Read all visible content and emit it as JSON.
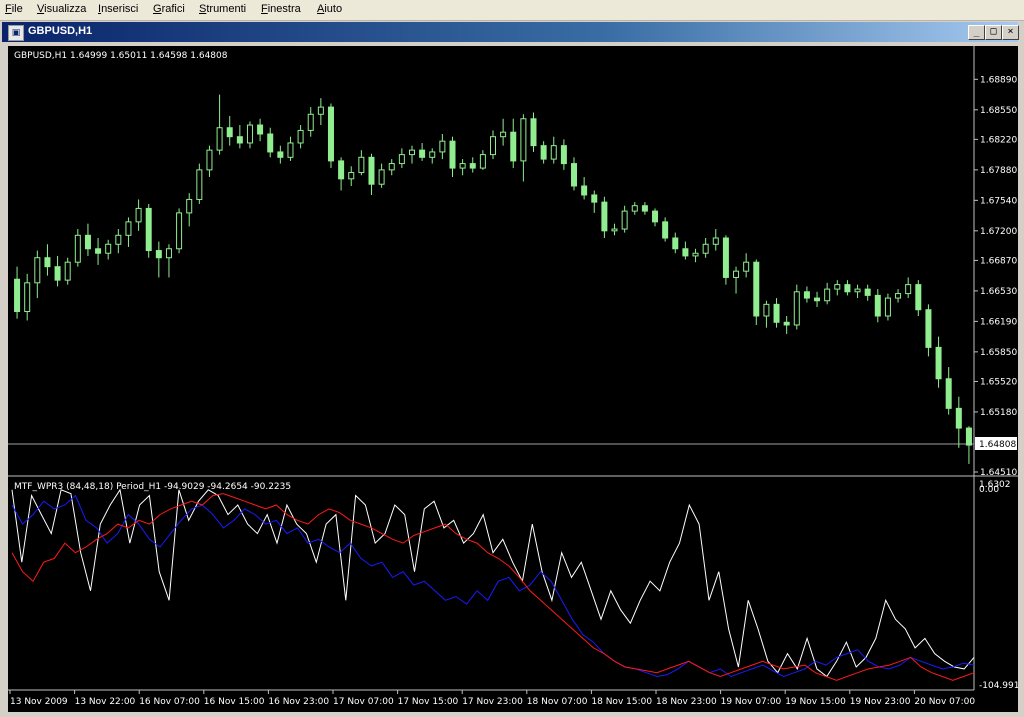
{
  "menu": [
    {
      "first": "F",
      "rest": "ile"
    },
    {
      "first": "V",
      "rest": "isualizza"
    },
    {
      "first": "I",
      "rest": "nserisci"
    },
    {
      "first": "G",
      "rest": "rafici"
    },
    {
      "first": "S",
      "rest": "trumenti"
    },
    {
      "first": "F",
      "rest": "inestra"
    },
    {
      "first": "A",
      "rest": "iuto"
    }
  ],
  "window": {
    "title": "GBPUSD,H1",
    "buttons": {
      "minimize": "_",
      "restore": "□",
      "close": "×"
    }
  },
  "price_panel": {
    "header": "GBPUSD,H1  1.64999 1.65011 1.64598 1.64808",
    "current_price": "1.64808",
    "axis_labels": [
      "1.68890",
      "1.68550",
      "1.68220",
      "1.67880",
      "1.67540",
      "1.67200",
      "1.66870",
      "1.66530",
      "1.66190",
      "1.65850",
      "1.65520",
      "1.65180",
      "1.64510"
    ]
  },
  "indicator_panel": {
    "header": "MTF_WPR3 (84,48,18) Period_H1 -94.9029 -94.2654 -90.2235",
    "axis_top": "0.00",
    "axis_top_overlap": "1.6302",
    "axis_bottom": "-104.991"
  },
  "time_axis": [
    "13 Nov 2009",
    "13 Nov 22:00",
    "16 Nov 07:00",
    "16 Nov 15:00",
    "16 Nov 23:00",
    "17 Nov 07:00",
    "17 Nov 15:00",
    "17 Nov 23:00",
    "18 Nov 07:00",
    "18 Nov 15:00",
    "18 Nov 23:00",
    "19 Nov 07:00",
    "19 Nov 15:00",
    "19 Nov 23:00",
    "20 Nov 07:00"
  ],
  "colors": {
    "background": "#000000",
    "candle": "#90ee90",
    "white_line": "#ffffff",
    "blue_line": "#1a1aff",
    "red_line": "#ff1a1a",
    "grid": "#c0c0c0"
  },
  "chart_data": {
    "type": "candlestick",
    "symbol": "GBPUSD",
    "timeframe": "H1",
    "ylim": [
      1.6451,
      1.6915
    ],
    "candles": [
      {
        "o": 1.6666,
        "h": 1.668,
        "l": 1.6622,
        "c": 1.663
      },
      {
        "o": 1.663,
        "h": 1.6672,
        "l": 1.662,
        "c": 1.6662
      },
      {
        "o": 1.6662,
        "h": 1.6698,
        "l": 1.6645,
        "c": 1.669
      },
      {
        "o": 1.669,
        "h": 1.6705,
        "l": 1.667,
        "c": 1.668
      },
      {
        "o": 1.668,
        "h": 1.6692,
        "l": 1.6658,
        "c": 1.6665
      },
      {
        "o": 1.6665,
        "h": 1.669,
        "l": 1.666,
        "c": 1.6685
      },
      {
        "o": 1.6685,
        "h": 1.6722,
        "l": 1.668,
        "c": 1.6715
      },
      {
        "o": 1.6715,
        "h": 1.6728,
        "l": 1.6692,
        "c": 1.67
      },
      {
        "o": 1.67,
        "h": 1.6712,
        "l": 1.6682,
        "c": 1.6695
      },
      {
        "o": 1.6695,
        "h": 1.671,
        "l": 1.6688,
        "c": 1.6705
      },
      {
        "o": 1.6705,
        "h": 1.6722,
        "l": 1.6695,
        "c": 1.6715
      },
      {
        "o": 1.6715,
        "h": 1.6735,
        "l": 1.6702,
        "c": 1.673
      },
      {
        "o": 1.673,
        "h": 1.6755,
        "l": 1.672,
        "c": 1.6745
      },
      {
        "o": 1.6745,
        "h": 1.675,
        "l": 1.669,
        "c": 1.6698
      },
      {
        "o": 1.6698,
        "h": 1.6708,
        "l": 1.6668,
        "c": 1.669
      },
      {
        "o": 1.669,
        "h": 1.6705,
        "l": 1.6668,
        "c": 1.67
      },
      {
        "o": 1.67,
        "h": 1.6745,
        "l": 1.6695,
        "c": 1.674
      },
      {
        "o": 1.674,
        "h": 1.6762,
        "l": 1.6725,
        "c": 1.6755
      },
      {
        "o": 1.6755,
        "h": 1.6795,
        "l": 1.675,
        "c": 1.6788
      },
      {
        "o": 1.6788,
        "h": 1.6815,
        "l": 1.678,
        "c": 1.681
      },
      {
        "o": 1.681,
        "h": 1.6872,
        "l": 1.6805,
        "c": 1.6835
      },
      {
        "o": 1.6835,
        "h": 1.6848,
        "l": 1.6815,
        "c": 1.6825
      },
      {
        "o": 1.6825,
        "h": 1.6838,
        "l": 1.6812,
        "c": 1.6818
      },
      {
        "o": 1.6818,
        "h": 1.6842,
        "l": 1.6812,
        "c": 1.6838
      },
      {
        "o": 1.6838,
        "h": 1.6845,
        "l": 1.682,
        "c": 1.6828
      },
      {
        "o": 1.6828,
        "h": 1.6835,
        "l": 1.6802,
        "c": 1.6808
      },
      {
        "o": 1.6808,
        "h": 1.6815,
        "l": 1.6795,
        "c": 1.6802
      },
      {
        "o": 1.6802,
        "h": 1.6825,
        "l": 1.6798,
        "c": 1.6818
      },
      {
        "o": 1.6818,
        "h": 1.6838,
        "l": 1.6812,
        "c": 1.6832
      },
      {
        "o": 1.6832,
        "h": 1.6858,
        "l": 1.6825,
        "c": 1.685
      },
      {
        "o": 1.685,
        "h": 1.6868,
        "l": 1.6838,
        "c": 1.6858
      },
      {
        "o": 1.6858,
        "h": 1.6862,
        "l": 1.679,
        "c": 1.6798
      },
      {
        "o": 1.6798,
        "h": 1.6802,
        "l": 1.6765,
        "c": 1.6778
      },
      {
        "o": 1.6778,
        "h": 1.6792,
        "l": 1.677,
        "c": 1.6785
      },
      {
        "o": 1.6785,
        "h": 1.681,
        "l": 1.6782,
        "c": 1.6802
      },
      {
        "o": 1.6802,
        "h": 1.6806,
        "l": 1.676,
        "c": 1.6772
      },
      {
        "o": 1.6772,
        "h": 1.6795,
        "l": 1.6768,
        "c": 1.6788
      },
      {
        "o": 1.6788,
        "h": 1.68,
        "l": 1.6782,
        "c": 1.6795
      },
      {
        "o": 1.6795,
        "h": 1.6812,
        "l": 1.679,
        "c": 1.6805
      },
      {
        "o": 1.6805,
        "h": 1.6815,
        "l": 1.6795,
        "c": 1.681
      },
      {
        "o": 1.681,
        "h": 1.6818,
        "l": 1.6798,
        "c": 1.6802
      },
      {
        "o": 1.6802,
        "h": 1.6812,
        "l": 1.6795,
        "c": 1.6808
      },
      {
        "o": 1.6808,
        "h": 1.6828,
        "l": 1.68,
        "c": 1.682
      },
      {
        "o": 1.682,
        "h": 1.6825,
        "l": 1.678,
        "c": 1.679
      },
      {
        "o": 1.679,
        "h": 1.68,
        "l": 1.6782,
        "c": 1.6795
      },
      {
        "o": 1.6795,
        "h": 1.6802,
        "l": 1.6785,
        "c": 1.679
      },
      {
        "o": 1.679,
        "h": 1.681,
        "l": 1.6788,
        "c": 1.6805
      },
      {
        "o": 1.6805,
        "h": 1.6832,
        "l": 1.68,
        "c": 1.6825
      },
      {
        "o": 1.6825,
        "h": 1.6845,
        "l": 1.6815,
        "c": 1.683
      },
      {
        "o": 1.683,
        "h": 1.6845,
        "l": 1.679,
        "c": 1.6798
      },
      {
        "o": 1.6798,
        "h": 1.685,
        "l": 1.6775,
        "c": 1.6845
      },
      {
        "o": 1.6845,
        "h": 1.6852,
        "l": 1.6808,
        "c": 1.6815
      },
      {
        "o": 1.6815,
        "h": 1.682,
        "l": 1.6795,
        "c": 1.68
      },
      {
        "o": 1.68,
        "h": 1.6825,
        "l": 1.6795,
        "c": 1.6815
      },
      {
        "o": 1.6815,
        "h": 1.6822,
        "l": 1.6788,
        "c": 1.6795
      },
      {
        "o": 1.6795,
        "h": 1.6802,
        "l": 1.6765,
        "c": 1.677
      },
      {
        "o": 1.677,
        "h": 1.678,
        "l": 1.6755,
        "c": 1.676
      },
      {
        "o": 1.676,
        "h": 1.6765,
        "l": 1.674,
        "c": 1.6752
      },
      {
        "o": 1.6752,
        "h": 1.6758,
        "l": 1.6712,
        "c": 1.672
      },
      {
        "o": 1.672,
        "h": 1.6728,
        "l": 1.6715,
        "c": 1.6722
      },
      {
        "o": 1.6722,
        "h": 1.6748,
        "l": 1.6718,
        "c": 1.6742
      },
      {
        "o": 1.6742,
        "h": 1.6752,
        "l": 1.6738,
        "c": 1.6748
      },
      {
        "o": 1.6748,
        "h": 1.6752,
        "l": 1.6738,
        "c": 1.6742
      },
      {
        "o": 1.6742,
        "h": 1.6745,
        "l": 1.6725,
        "c": 1.673
      },
      {
        "o": 1.673,
        "h": 1.6735,
        "l": 1.6708,
        "c": 1.6712
      },
      {
        "o": 1.6712,
        "h": 1.6718,
        "l": 1.6695,
        "c": 1.67
      },
      {
        "o": 1.67,
        "h": 1.6708,
        "l": 1.6688,
        "c": 1.6692
      },
      {
        "o": 1.6692,
        "h": 1.67,
        "l": 1.6685,
        "c": 1.6695
      },
      {
        "o": 1.6695,
        "h": 1.6712,
        "l": 1.669,
        "c": 1.6705
      },
      {
        "o": 1.6705,
        "h": 1.6722,
        "l": 1.6698,
        "c": 1.6712
      },
      {
        "o": 1.6712,
        "h": 1.6715,
        "l": 1.666,
        "c": 1.6668
      },
      {
        "o": 1.6668,
        "h": 1.668,
        "l": 1.665,
        "c": 1.6675
      },
      {
        "o": 1.6675,
        "h": 1.6695,
        "l": 1.6668,
        "c": 1.6685
      },
      {
        "o": 1.6685,
        "h": 1.6688,
        "l": 1.6615,
        "c": 1.6625
      },
      {
        "o": 1.6625,
        "h": 1.6642,
        "l": 1.6612,
        "c": 1.6638
      },
      {
        "o": 1.6638,
        "h": 1.6645,
        "l": 1.6612,
        "c": 1.6618
      },
      {
        "o": 1.6618,
        "h": 1.6625,
        "l": 1.6605,
        "c": 1.6615
      },
      {
        "o": 1.6615,
        "h": 1.666,
        "l": 1.661,
        "c": 1.6652
      },
      {
        "o": 1.6652,
        "h": 1.6658,
        "l": 1.664,
        "c": 1.6645
      },
      {
        "o": 1.6645,
        "h": 1.6652,
        "l": 1.6635,
        "c": 1.6642
      },
      {
        "o": 1.6642,
        "h": 1.6662,
        "l": 1.6638,
        "c": 1.6655
      },
      {
        "o": 1.6655,
        "h": 1.6665,
        "l": 1.6648,
        "c": 1.666
      },
      {
        "o": 1.666,
        "h": 1.6665,
        "l": 1.6648,
        "c": 1.6652
      },
      {
        "o": 1.6652,
        "h": 1.666,
        "l": 1.6645,
        "c": 1.6655
      },
      {
        "o": 1.6655,
        "h": 1.666,
        "l": 1.6642,
        "c": 1.6648
      },
      {
        "o": 1.6648,
        "h": 1.6655,
        "l": 1.6618,
        "c": 1.6625
      },
      {
        "o": 1.6625,
        "h": 1.665,
        "l": 1.662,
        "c": 1.6645
      },
      {
        "o": 1.6645,
        "h": 1.6655,
        "l": 1.664,
        "c": 1.665
      },
      {
        "o": 1.665,
        "h": 1.6668,
        "l": 1.6645,
        "c": 1.666
      },
      {
        "o": 1.666,
        "h": 1.6665,
        "l": 1.6625,
        "c": 1.6632
      },
      {
        "o": 1.6632,
        "h": 1.6638,
        "l": 1.658,
        "c": 1.659
      },
      {
        "o": 1.659,
        "h": 1.6602,
        "l": 1.6545,
        "c": 1.6555
      },
      {
        "o": 1.6555,
        "h": 1.6568,
        "l": 1.6515,
        "c": 1.6522
      },
      {
        "o": 1.6522,
        "h": 1.6535,
        "l": 1.6478,
        "c": 1.65
      },
      {
        "o": 1.65,
        "h": 1.6502,
        "l": 1.646,
        "c": 1.6481
      }
    ],
    "indicator": {
      "name": "MTF_WPR3 (84,48,18) Period_H1",
      "ylim": [
        -104.991,
        0
      ],
      "series": [
        {
          "color": "white",
          "values": [
            -2,
            -40,
            -5,
            -15,
            -25,
            -2,
            -4,
            -35,
            -55,
            -20,
            -10,
            -2,
            -30,
            -10,
            -5,
            -45,
            -60,
            -2,
            -18,
            -8,
            -2,
            -5,
            -15,
            -10,
            -20,
            -25,
            -15,
            -30,
            -10,
            -20,
            -25,
            -40,
            -20,
            -15,
            -60,
            -5,
            -10,
            -30,
            -25,
            -10,
            -15,
            -45,
            -12,
            -8,
            -22,
            -18,
            -30,
            -25,
            -15,
            -35,
            -28,
            -40,
            -50,
            -20,
            -45,
            -60,
            -35,
            -48,
            -40,
            -55,
            -70,
            -55,
            -65,
            -72,
            -60,
            -50,
            -55,
            -40,
            -30,
            -10,
            -20,
            -60,
            -45,
            -75,
            -95,
            -60,
            -75,
            -92,
            -98,
            -88,
            -96,
            -80,
            -96,
            -100,
            -92,
            -82,
            -95,
            -90,
            -80,
            -60,
            -70,
            -75,
            -85,
            -80,
            -88,
            -92,
            -95,
            -96,
            -90
          ]
        },
        {
          "color": "blue",
          "values": [
            -10,
            -20,
            -15,
            -8,
            -12,
            -10,
            -5,
            -18,
            -22,
            -30,
            -25,
            -15,
            -20,
            -28,
            -32,
            -25,
            -18,
            -12,
            -10,
            -15,
            -22,
            -18,
            -12,
            -15,
            -20,
            -18,
            -25,
            -22,
            -30,
            -28,
            -32,
            -35,
            -30,
            -38,
            -42,
            -40,
            -48,
            -45,
            -52,
            -50,
            -55,
            -60,
            -58,
            -62,
            -55,
            -60,
            -50,
            -48,
            -55,
            -52,
            -45,
            -50,
            -60,
            -70,
            -78,
            -82,
            -88,
            -92,
            -95,
            -96,
            -98,
            -100,
            -99,
            -96,
            -92,
            -95,
            -98,
            -96,
            -100,
            -98,
            -96,
            -94,
            -97,
            -100,
            -98,
            -96,
            -92,
            -94,
            -90,
            -88,
            -86,
            -92,
            -95,
            -96,
            -94,
            -90,
            -92,
            -94,
            -96,
            -95,
            -93,
            -94
          ]
        },
        {
          "color": "red",
          "values": [
            -35,
            -45,
            -50,
            -40,
            -38,
            -30,
            -35,
            -32,
            -28,
            -25,
            -20,
            -22,
            -18,
            -20,
            -15,
            -12,
            -10,
            -8,
            -10,
            -5,
            -4,
            -6,
            -8,
            -10,
            -12,
            -10,
            -15,
            -18,
            -20,
            -15,
            -12,
            -14,
            -18,
            -20,
            -22,
            -25,
            -28,
            -30,
            -26,
            -24,
            -22,
            -20,
            -25,
            -28,
            -30,
            -35,
            -38,
            -42,
            -48,
            -55,
            -60,
            -65,
            -70,
            -75,
            -80,
            -85,
            -88,
            -92,
            -95,
            -96,
            -97,
            -98,
            -96,
            -94,
            -92,
            -95,
            -98,
            -100,
            -98,
            -96,
            -94,
            -92,
            -94,
            -96,
            -95,
            -94,
            -98,
            -100,
            -102,
            -100,
            -98,
            -96,
            -95,
            -94,
            -92,
            -90,
            -95,
            -98,
            -100,
            -102,
            -100,
            -98
          ]
        }
      ]
    }
  }
}
